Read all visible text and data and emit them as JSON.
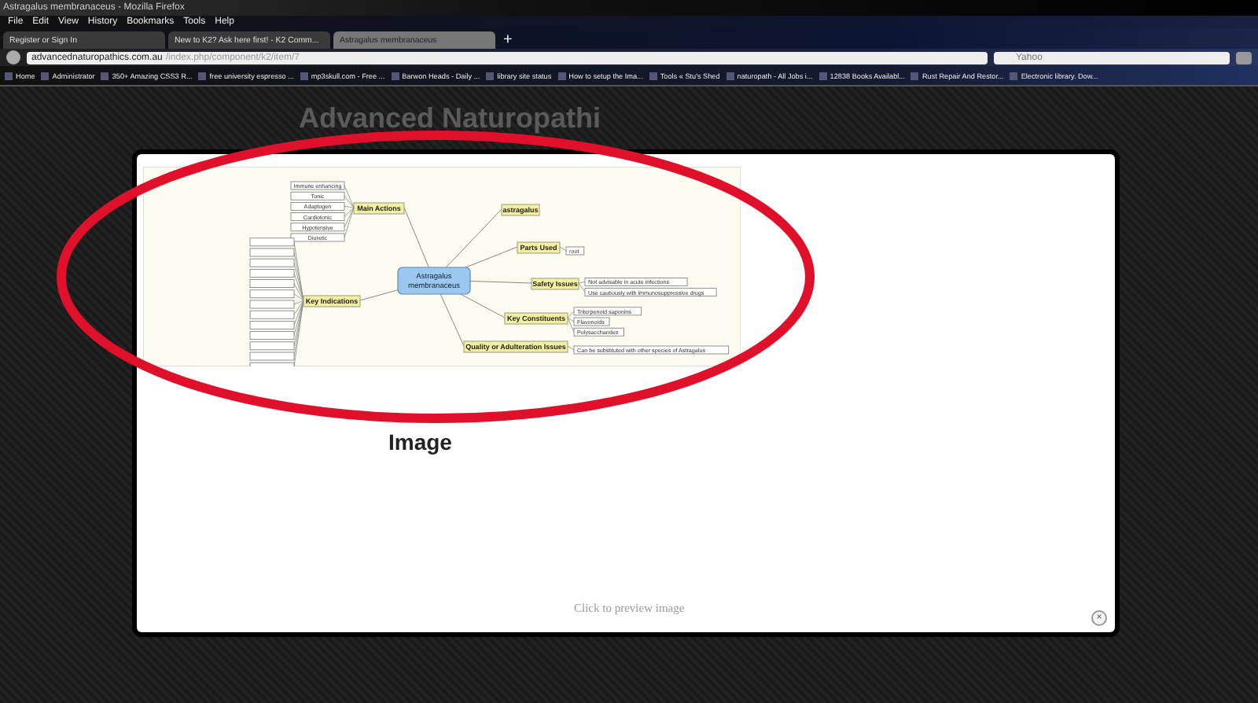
{
  "window": {
    "title": "Astragalus membranaceus - Mozilla Firefox"
  },
  "menu": [
    "File",
    "Edit",
    "View",
    "History",
    "Bookmarks",
    "Tools",
    "Help"
  ],
  "tabs": [
    {
      "label": "Register or Sign In",
      "selected": false
    },
    {
      "label": "New to K2? Ask here first! - K2 Comm...",
      "selected": false
    },
    {
      "label": "Astragalus membranaceus",
      "selected": true
    }
  ],
  "address": {
    "host": "advancednaturopathics.com.au",
    "path": "/index.php/component/k2/item/7"
  },
  "search": {
    "placeholder": "Yahoo"
  },
  "bookmarks": [
    "Home",
    "Administrator",
    "350+ Amazing CSS3 R...",
    "free university espresso ...",
    "mp3skull.com - Free ...",
    "Barwon Heads - Daily ...",
    "library site status",
    "How to setup the Ima...",
    "Tools « Stu's Shed",
    "naturopath - All Jobs i...",
    "12838 Books Availabl...",
    "Rust Repair And Restor...",
    "Electronic library. Dow..."
  ],
  "page": {
    "heading": "Advanced Naturopathi"
  },
  "modal": {
    "mind_map": {
      "center": [
        "Astragalus",
        "membranaceus"
      ],
      "branches": [
        {
          "label": "Main Actions",
          "children": [
            "Immune enhancing",
            "Tonic",
            "Adaptogen",
            "Cardiotonic",
            "Hypotensive",
            "Diuretic"
          ]
        },
        {
          "label": "Key Indications"
        },
        {
          "label": "astragalus"
        },
        {
          "label": "Parts Used",
          "children": [
            "root"
          ]
        },
        {
          "label": "Safety Issues",
          "children": [
            "Not advisable in acute infections",
            "Use cautiously with immunosuppressive drugs"
          ]
        },
        {
          "label": "Key Constituents",
          "children": [
            "Triterpenoid saponins",
            "Flavonoids",
            "Polysaccharides"
          ]
        },
        {
          "label": "Quality or Adulteration Issues",
          "children": [
            "Can be substituted with other species of Astragalus"
          ]
        }
      ]
    },
    "caption": "Image",
    "hint": "Click to preview image",
    "close_symbol": "×"
  },
  "new_tab_symbol": "+"
}
